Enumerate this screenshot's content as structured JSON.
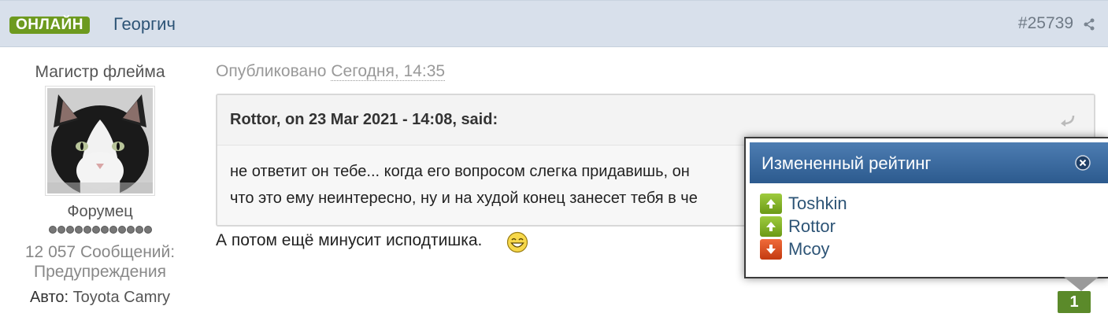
{
  "header": {
    "online_label": "ОНЛАЙН",
    "author": "Георгич",
    "post_number": "#25739",
    "share_icon": "share-icon"
  },
  "user": {
    "title": "Магистр флейма",
    "group": "Форумец",
    "pips": 12,
    "post_count_line1": "12 057 Сообщений:",
    "post_count_line2": "Предупреждения",
    "car_label": "Авто:",
    "car_value": "Toyota Camry"
  },
  "post": {
    "published_label": "Опубликовано",
    "published_date": "Сегодня, 14:35",
    "quote_cite": "Rottor, on 23 Mar 2021 - 14:08, said:",
    "quote_line1": "не ответит он тебе... когда его вопросом слегка придавишь, он",
    "quote_line2": "что это ему неинтересно, ну и на худой конец занесет тебя в че",
    "text": "А потом ещё минусит исподтишка.",
    "smiley_icon": "laughing-smiley-icon"
  },
  "reputation": {
    "popup_title": "Измененный рейтинг",
    "entries": [
      {
        "name": "Toshkin",
        "direction": "up"
      },
      {
        "name": "Rottor",
        "direction": "up"
      },
      {
        "name": "Mcoy",
        "direction": "down"
      }
    ],
    "count": "1"
  },
  "colors": {
    "header_bg": "#d8e0eb",
    "online_green": "#6d9a1f",
    "link_blue": "#2d5476",
    "popup_blue": "#2c5a8e",
    "rep_green": "#5b8a2a",
    "rep_red": "#c33a10"
  }
}
